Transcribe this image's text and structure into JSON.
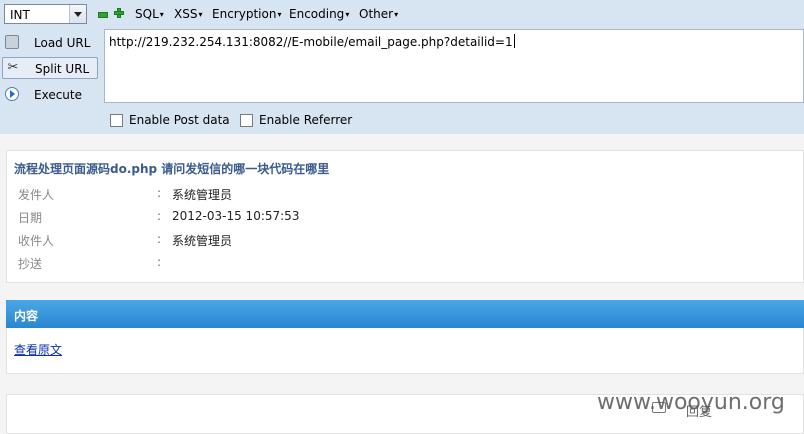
{
  "toolbar": {
    "select_value": "INT",
    "menus": [
      "SQL",
      "XSS",
      "Encryption",
      "Encoding",
      "Other"
    ],
    "side_buttons": [
      "Load URL",
      "Split URL",
      "Execute"
    ],
    "url": "http://219.232.254.131:8082//E-mobile/email_page.php?detailid=1",
    "checkboxes": [
      "Enable Post data",
      "Enable Referrer"
    ]
  },
  "email": {
    "title": "流程处理页面源码do.php 请问发短信的哪一块代码在哪里",
    "fields": [
      {
        "label": "发件人",
        "value": "系统管理员"
      },
      {
        "label": "日期",
        "value": "2012-03-15 10:57:53"
      },
      {
        "label": "收件人",
        "value": "系统管理员"
      },
      {
        "label": "抄送",
        "value": ""
      }
    ],
    "colon": ":"
  },
  "content": {
    "header": "内容",
    "link": "查看原文"
  },
  "footer": {
    "reply": "回复",
    "watermark": "www.wooyun.org"
  }
}
